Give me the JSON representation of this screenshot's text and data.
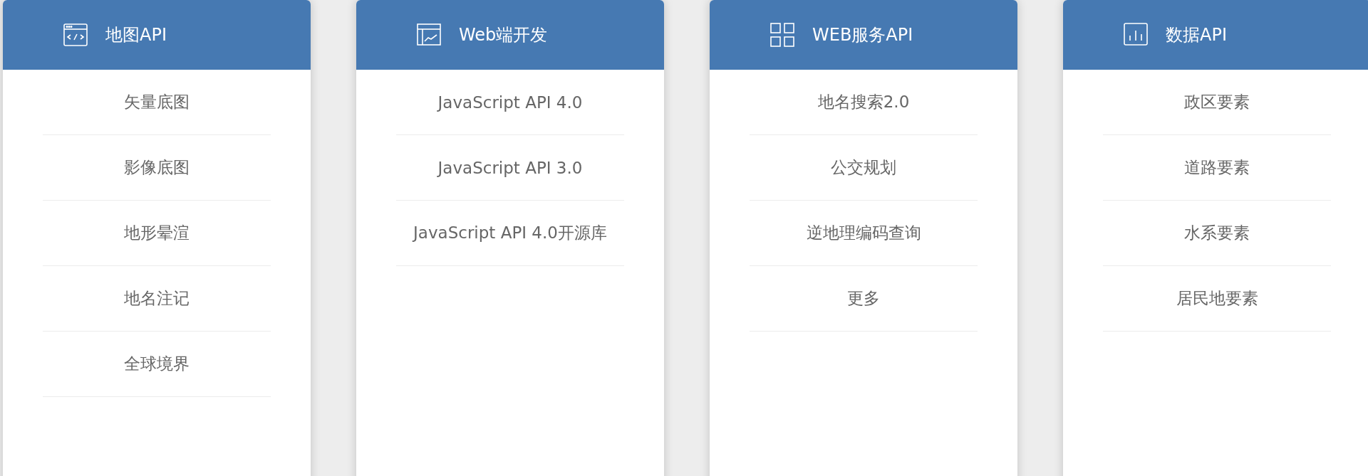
{
  "cards": [
    {
      "kind": "code-window",
      "title": "地图API",
      "items": [
        "矢量底图",
        "影像底图",
        "地形晕渲",
        "地名注记",
        "全球境界"
      ]
    },
    {
      "kind": "chart-window",
      "title": "Web端开发",
      "items": [
        "JavaScript API 4.0",
        "JavaScript API 3.0",
        "JavaScript API 4.0开源库"
      ]
    },
    {
      "kind": "grid",
      "title": "WEB服务API",
      "items": [
        "地名搜索2.0",
        "公交规划",
        "逆地理编码查询",
        "更多"
      ]
    },
    {
      "kind": "bar-chart",
      "title": "数据API",
      "items": [
        "政区要素",
        "道路要素",
        "水系要素",
        "居民地要素"
      ]
    }
  ]
}
